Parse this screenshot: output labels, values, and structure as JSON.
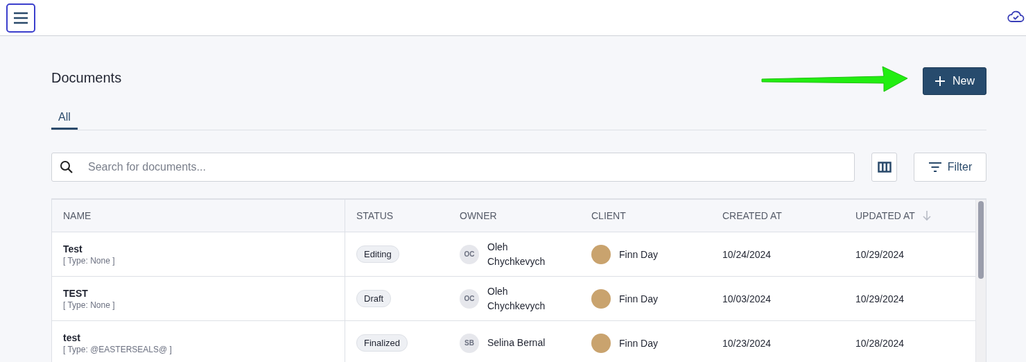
{
  "page": {
    "title": "Documents"
  },
  "tabs": [
    {
      "label": "All",
      "selected": true
    }
  ],
  "new_button": {
    "label": "New"
  },
  "search": {
    "placeholder": "Search for documents..."
  },
  "filter_button": {
    "label": "Filter"
  },
  "table": {
    "columns": [
      {
        "label": "NAME",
        "sorted": false
      },
      {
        "label": "STATUS",
        "sorted": false
      },
      {
        "label": "OWNER",
        "sorted": false
      },
      {
        "label": "CLIENT",
        "sorted": false
      },
      {
        "label": "CREATED AT",
        "sorted": false
      },
      {
        "label": "UPDATED AT",
        "sorted": true
      }
    ],
    "rows": [
      {
        "name": "Test",
        "type": "[ Type: None ]",
        "status": "Editing",
        "owner_initials": "OC",
        "owner": "Oleh Chychkevych",
        "client": "Finn Day",
        "created": "10/24/2024",
        "updated": "10/29/2024"
      },
      {
        "name": "TEST",
        "type": "[ Type: None ]",
        "status": "Draft",
        "owner_initials": "OC",
        "owner": "Oleh Chychkevych",
        "client": "Finn Day",
        "created": "10/03/2024",
        "updated": "10/29/2024"
      },
      {
        "name": "test",
        "type": "[ Type: @EASTERSEALS@ ]",
        "status": "Finalized",
        "owner_initials": "SB",
        "owner": "Selina Bernal",
        "client": "Finn Day",
        "created": "10/23/2024",
        "updated": "10/28/2024"
      }
    ]
  }
}
